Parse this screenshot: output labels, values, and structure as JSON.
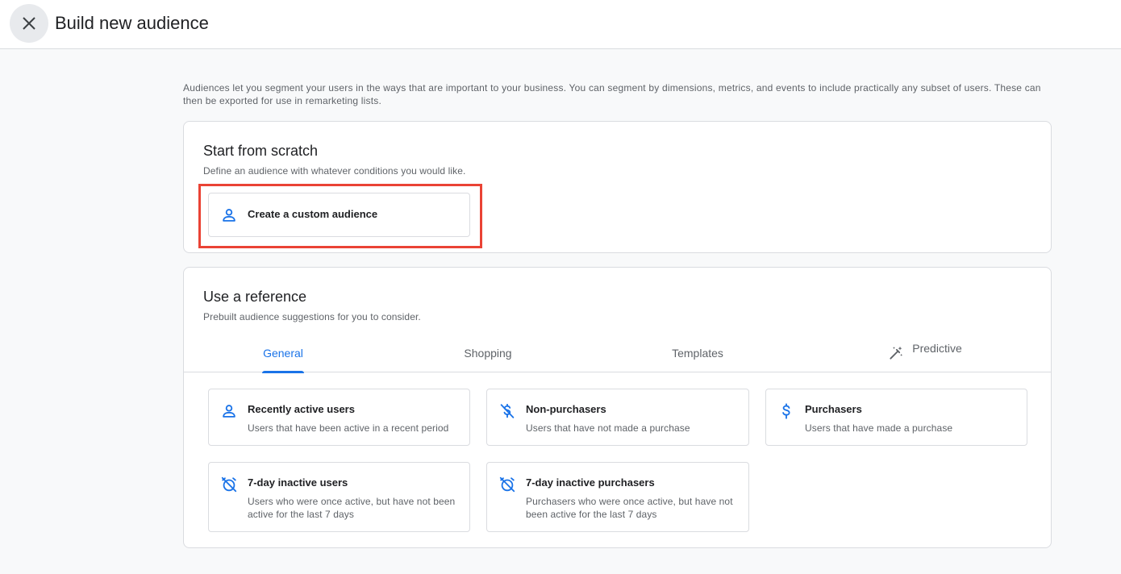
{
  "header": {
    "title": "Build new audience"
  },
  "intro": "Audiences let you segment your users in the ways that are important to your business. You can segment by dimensions, metrics, and events to include practically any subset of users. These can then be exported for use in remarketing lists.",
  "scratch": {
    "title": "Start from scratch",
    "subtitle": "Define an audience with whatever conditions you would like.",
    "button_label": "Create a custom audience"
  },
  "reference": {
    "title": "Use a reference",
    "subtitle": "Prebuilt audience suggestions for you to consider.",
    "tabs": [
      "General",
      "Shopping",
      "Templates",
      "Predictive"
    ],
    "active_tab": "General",
    "items": [
      {
        "name": "Recently active users",
        "desc": "Users that have been active in a recent period",
        "icon": "person-icon"
      },
      {
        "name": "Non-purchasers",
        "desc": "Users that have not made a purchase",
        "icon": "money-off-icon"
      },
      {
        "name": "Purchasers",
        "desc": "Users that have made a purchase",
        "icon": "dollar-icon"
      },
      {
        "name": "7-day inactive users",
        "desc": "Users who were once active, but have not been active for the last 7 days",
        "icon": "alarm-off-icon"
      },
      {
        "name": "7-day inactive purchasers",
        "desc": "Purchasers who were once active, but have not been active for the last 7 days",
        "icon": "alarm-off-icon"
      }
    ]
  },
  "colors": {
    "accent": "#1a73e8",
    "highlight": "#ea4335"
  }
}
